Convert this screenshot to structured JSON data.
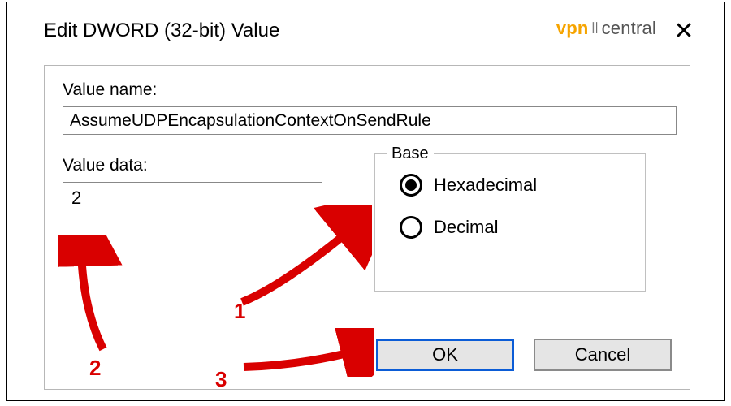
{
  "dialog": {
    "title": "Edit DWORD (32-bit) Value",
    "close_glyph": "✕"
  },
  "logo": {
    "left": "vpn",
    "mid": "⦀",
    "right": "central"
  },
  "valueName": {
    "label": "Value name:",
    "value": "AssumeUDPEncapsulationContextOnSendRule"
  },
  "valueData": {
    "label": "Value data:",
    "value": "2"
  },
  "base": {
    "legend": "Base",
    "options": {
      "hex": "Hexadecimal",
      "dec": "Decimal"
    },
    "selected": "hex"
  },
  "buttons": {
    "ok": "OK",
    "cancel": "Cancel"
  },
  "annotations": {
    "n1": "1",
    "n2": "2",
    "n3": "3"
  }
}
